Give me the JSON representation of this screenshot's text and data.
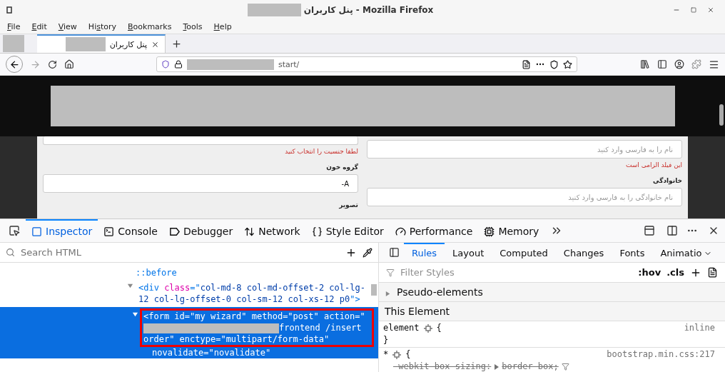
{
  "window": {
    "title": "پنل کاربران - Mozilla Firefox"
  },
  "menu": [
    {
      "key": "F",
      "after": "ile"
    },
    {
      "key": "E",
      "after": "dit"
    },
    {
      "key": "V",
      "after": "iew"
    },
    {
      "before": "Hi",
      "key": "s",
      "after": "tory"
    },
    {
      "key": "B",
      "after": "ookmarks"
    },
    {
      "key": "T",
      "after": "ools"
    },
    {
      "key": "H",
      "after": "elp"
    }
  ],
  "tabs": [
    {
      "title": "پنل کاربران",
      "selected": true
    }
  ],
  "url": {
    "text": "start/"
  },
  "page": {
    "left_column": [
      {
        "kind": "field",
        "cut": true
      },
      {
        "kind": "error",
        "text": "لطفا جنسیت را انتخاب کنید"
      },
      {
        "kind": "label",
        "text": "گروه خون"
      },
      {
        "kind": "field",
        "value": "A-"
      },
      {
        "kind": "label",
        "text": "تصویر"
      }
    ],
    "right_column": [
      {
        "kind": "field",
        "placeholder": "نام را به فارسی وارد کنید"
      },
      {
        "kind": "error",
        "text": "این فیلد الزامی است"
      },
      {
        "kind": "label",
        "text": "خانوادگی"
      },
      {
        "kind": "field",
        "placeholder": "نام خانوادگی را به فارسی وارد کنید"
      }
    ]
  },
  "devtools": {
    "tools": [
      {
        "kind": "inspector",
        "label": "Inspector",
        "selected": true
      },
      {
        "kind": "console",
        "label": "Console",
        "selected": false
      },
      {
        "kind": "debugger",
        "label": "Debugger",
        "selected": false
      },
      {
        "kind": "network",
        "label": "Network",
        "selected": false
      },
      {
        "kind": "style",
        "label": "Style Editor",
        "selected": false
      },
      {
        "kind": "performance",
        "label": "Performance",
        "selected": false
      },
      {
        "kind": "memory",
        "label": "Memory",
        "selected": false
      }
    ],
    "search": {
      "placeholder": "Search HTML"
    },
    "markup": [
      {
        "kind": "pseudo",
        "text": "::before",
        "selected": false
      },
      {
        "kind": "element",
        "expanded": true,
        "selected": false,
        "boxed": false,
        "segments": [
          {
            "kind": "tag",
            "text": "<div"
          },
          {
            "kind": "attr",
            "text": "class"
          },
          {
            "kind": "punct",
            "text": "=\""
          },
          {
            "kind": "value",
            "text": "col-md-8 col-md-offset-2 col-lg-12 col-lg-offset-0 col-sm-12 col-xs-12 p0"
          },
          {
            "kind": "punct",
            "text": "\">"
          }
        ]
      },
      {
        "kind": "element",
        "expanded": true,
        "selected": true,
        "boxed": true,
        "segments": [
          {
            "kind": "tag",
            "text": "<form"
          },
          {
            "kind": "attr",
            "text": "id"
          },
          {
            "kind": "punct",
            "text": "=\""
          },
          {
            "kind": "value",
            "text": "my wizard"
          },
          {
            "kind": "punct",
            "text": "\""
          },
          {
            "kind": "attr",
            "text": "method"
          },
          {
            "kind": "punct",
            "text": "=\""
          },
          {
            "kind": "value",
            "text": "post"
          },
          {
            "kind": "punct",
            "text": "\""
          },
          {
            "kind": "attr",
            "text": "action"
          },
          {
            "kind": "punct",
            "text": "=\""
          },
          {
            "kind": "redacted"
          },
          {
            "kind": "value",
            "text": "frontend /insert order"
          },
          {
            "kind": "punct",
            "text": "\""
          },
          {
            "kind": "attr",
            "text": "enctype"
          },
          {
            "kind": "punct",
            "text": "=\""
          },
          {
            "kind": "value",
            "text": "multipart/form-data"
          },
          {
            "kind": "punct",
            "text": "\""
          }
        ],
        "tail": [
          {
            "kind": "attr",
            "text": "novalidate"
          },
          {
            "kind": "punct",
            "text": "=\""
          },
          {
            "kind": "value",
            "text": "novalidate"
          },
          {
            "kind": "punct",
            "text": "\""
          }
        ]
      }
    ],
    "sidebar_tabs": [
      {
        "label": "Rules",
        "selected": true
      },
      {
        "label": "Layout",
        "selected": false
      },
      {
        "label": "Computed",
        "selected": false
      },
      {
        "label": "Changes",
        "selected": false
      },
      {
        "label": "Fonts",
        "selected": false
      },
      {
        "label": "Animatio",
        "selected": false
      }
    ],
    "filter": {
      "placeholder": "Filter Styles"
    },
    "toggles": [
      ":hov",
      ".cls"
    ],
    "sections": [
      {
        "kind": "collapsible",
        "label": "Pseudo-elements",
        "expanded": false
      },
      {
        "kind": "header",
        "label": "This Element"
      }
    ],
    "rules": [
      {
        "selector": "element",
        "open": "{",
        "source": "inline",
        "close": "}"
      },
      {
        "selector": "*",
        "open": "{",
        "source": "bootstrap.min.css:217",
        "declarations": [
          {
            "property": "-webkit-box-sizing:",
            "value": "border-box;",
            "overridden": true
          }
        ]
      }
    ]
  }
}
